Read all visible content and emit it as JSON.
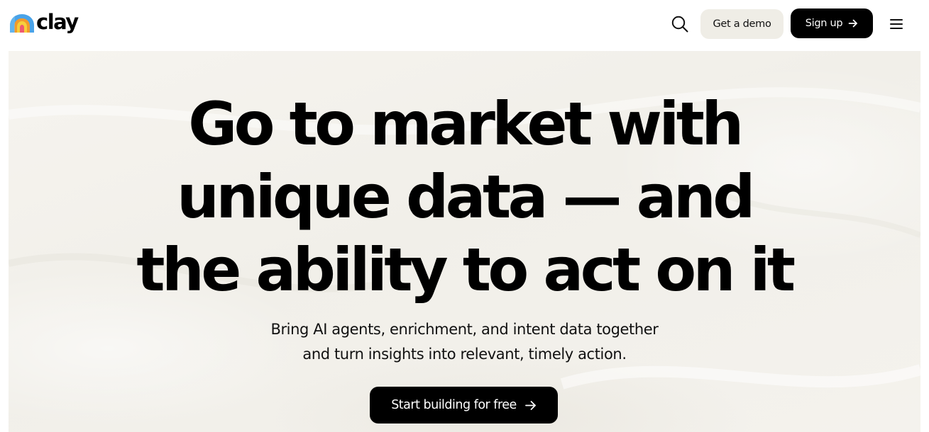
{
  "brand": {
    "name": "clay",
    "colors": {
      "primary_dark": "#000000",
      "demo_button_bg": "#efede6",
      "hero_bg": "#f3f1ec",
      "logo_blue": "#4aa3e8",
      "logo_orange": "#f39a2b",
      "logo_yellow": "#f7cf3c",
      "logo_pink": "#ef5a6f"
    }
  },
  "header": {
    "search_icon": "search-icon",
    "demo_label": "Get a demo",
    "signup_label": "Sign up",
    "signup_icon": "arrow-right-icon",
    "menu_icon": "hamburger-menu-icon"
  },
  "hero": {
    "headline": {
      "line1": "Go to market with",
      "line2": "unique data — and",
      "line3": "the ability to act on it"
    },
    "subtitle": {
      "line1": "Bring AI agents, enrichment, and intent data together",
      "line2": "and turn insights into relevant, timely action."
    },
    "cta_label": "Start building for free",
    "cta_icon": "arrow-right-icon"
  }
}
